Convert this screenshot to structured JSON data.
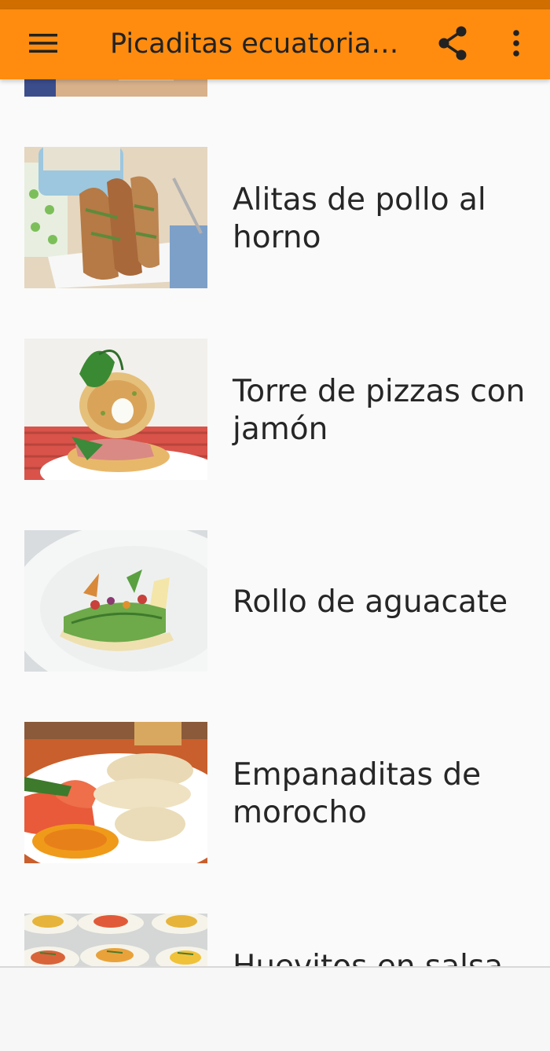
{
  "app_bar": {
    "title": "Picaditas ecuatorianas",
    "icons": {
      "menu": "hamburger-menu-icon",
      "share": "share-icon",
      "more": "more-vert-icon"
    },
    "color": "#ff8c0f",
    "status_bar_color": "#d06f00"
  },
  "recipes": [
    {
      "title": "Alitas de pollo al horno",
      "image": "chicken wings on a white plate"
    },
    {
      "title": "Torre de pizzas con jamón",
      "image": "stacked mini pizzas with ham and basil"
    },
    {
      "title": "Rollo de aguacate",
      "image": "avocado roll on a white plate"
    },
    {
      "title": "Empanaditas de morocho",
      "image": "corn empanadas with tomato and sauce"
    },
    {
      "title": "Huevitos en salsa",
      "image": "deviled eggs with salsa"
    }
  ]
}
